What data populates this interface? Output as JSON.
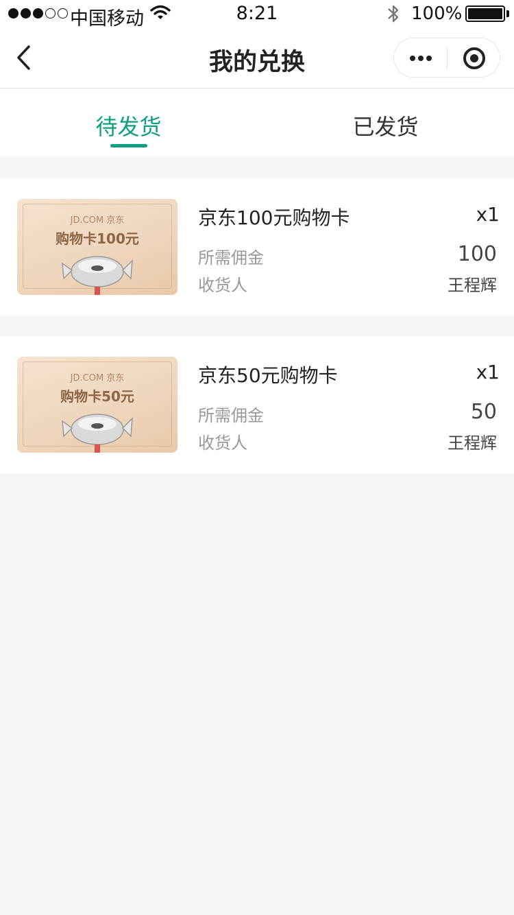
{
  "status_bar": {
    "carrier": "中国移动",
    "time": "8:21",
    "battery": "100%"
  },
  "navbar": {
    "title": "我的兑换"
  },
  "tabs": [
    {
      "label": "待发货",
      "active": true
    },
    {
      "label": "已发货",
      "active": false
    }
  ],
  "colors": {
    "accent": "#0e9f82",
    "background": "#f4f5f7"
  },
  "orders": [
    {
      "image_brand": "JD.COM 京东",
      "image_label": "购物卡100元",
      "name": "京东100元购物卡",
      "qty": "x1",
      "commission_label": "所需佣金",
      "commission_value": "100",
      "receiver_label": "收货人",
      "receiver_value": "王程辉"
    },
    {
      "image_brand": "JD.COM 京东",
      "image_label": "购物卡50元",
      "name": "京东50元购物卡",
      "qty": "x1",
      "commission_label": "所需佣金",
      "commission_value": "50",
      "receiver_label": "收货人",
      "receiver_value": "王程辉"
    }
  ]
}
